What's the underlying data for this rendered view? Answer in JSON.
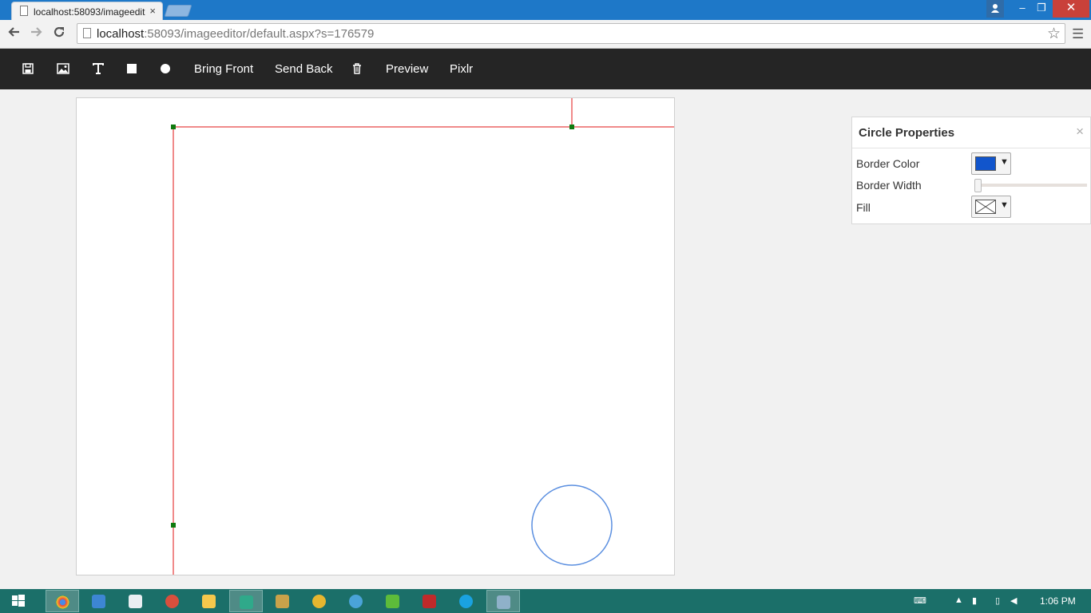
{
  "browser": {
    "tab_title": "localhost:58093/imageedit",
    "tab_close": "×",
    "url_host": "localhost",
    "url_rest": ":58093/imageeditor/default.aspx?s=176579",
    "star_icon": "star-icon",
    "menu_icon": "☰",
    "minimize": "–",
    "restore": "❐",
    "close": "✕"
  },
  "toolbar": {
    "save_icon": "save-icon",
    "image_icon": "image-icon",
    "text_icon": "text-icon",
    "rectangle_icon": "square-icon",
    "circle_icon": "circle-icon",
    "bring_front": "Bring Front",
    "send_back": "Send Back",
    "delete_icon": "trash-icon",
    "preview": "Preview",
    "pixlr": "Pixlr"
  },
  "canvas": {
    "selection_color": "#f08a8a",
    "handle_color": "#0f7a0f",
    "circle_stroke": "#5b8fe0"
  },
  "properties": {
    "title": "Circle Properties",
    "close": "×",
    "border_color_label": "Border Color",
    "border_color_value": "#1155cc",
    "border_width_label": "Border Width",
    "border_width_value": 0,
    "fill_label": "Fill",
    "fill_value": "none",
    "arrow": "▼"
  },
  "taskbar": {
    "time": "1:06 PM",
    "apps": [
      "chrome",
      "visual-studio",
      "notepad",
      "paint",
      "file-explorer",
      "visual-studio-active",
      "tools",
      "paint-brush",
      "app-browser",
      "green-app",
      "filezilla",
      "skype",
      "remote-app"
    ]
  }
}
